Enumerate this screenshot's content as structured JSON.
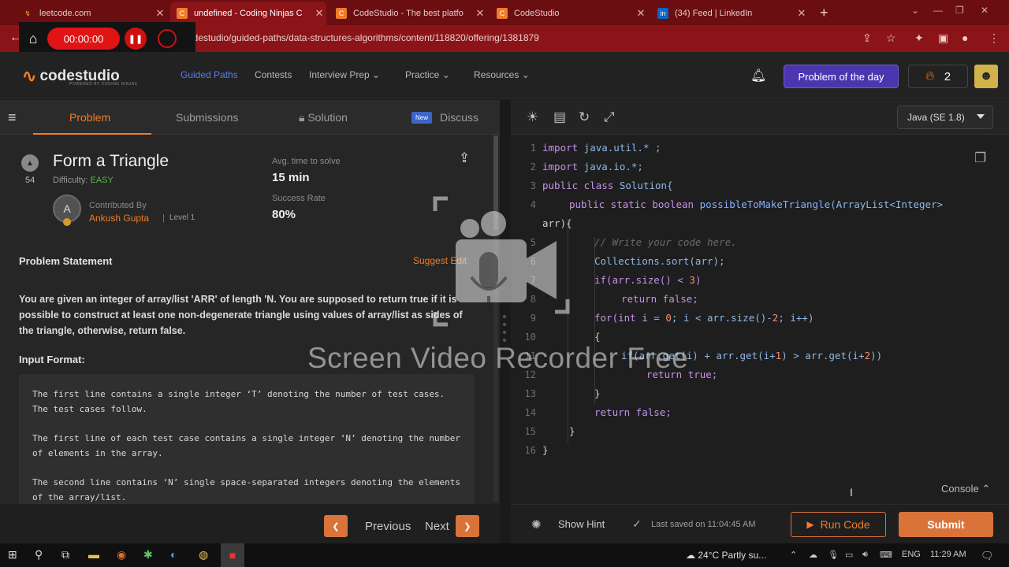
{
  "browser": {
    "tabs": [
      {
        "label": "leetcode.com",
        "favicon": "leetcode-icon",
        "active": false
      },
      {
        "label": "undefined - Coding Ninjas C",
        "favicon": "codingninjas-icon",
        "active": true
      },
      {
        "label": "CodeStudio - The best platfo",
        "favicon": "codingninjas-icon",
        "active": false
      },
      {
        "label": "CodeStudio",
        "favicon": "codingninjas-icon",
        "active": false
      },
      {
        "label": "(34) Feed | LinkedIn",
        "favicon": "linkedin-icon",
        "active": false
      }
    ],
    "url": "odestudio/guided-paths/data-structures-algorithms/content/118820/offering/1381879"
  },
  "recorder": {
    "time": "00:00:00"
  },
  "site": {
    "logo": "codestudio",
    "logo_sub": "POWERED BY CODING NINJAS",
    "nav": [
      "Guided Paths",
      "Contests",
      "Interview Prep",
      "Practice",
      "Resources"
    ],
    "potd": "Problem of the day",
    "streak": "2"
  },
  "problem": {
    "tabs": [
      "Problem",
      "Submissions",
      "Solution",
      "Discuss"
    ],
    "new_badge": "New",
    "upvotes": "54",
    "title": "Form a Triangle",
    "difficulty_label": "Difficulty:",
    "difficulty": "EASY",
    "avg_label": "Avg. time to solve",
    "avg_value": "15 min",
    "success_label": "Success Rate",
    "success_value": "80%",
    "contrib_initial": "A",
    "contrib_label": "Contributed By",
    "contrib_name": "Ankush Gupta",
    "contrib_level": "Level 1",
    "statement_header": "Problem Statement",
    "suggest_edit": "Suggest Edit",
    "statement": "You are given an integer of array/list 'ARR' of length 'N. You are supposed to return true if it is possible to construct at least one non-degenerate triangle using values of array/list as sides of the triangle, otherwise, return false.",
    "input_header": "Input Format:",
    "input_lines": [
      "The first line contains a single integer ‘T’ denoting the number of test cases. The test cases follow.",
      "The first line of each test case contains a single integer ‘N’ denoting the number of elements in the array.",
      "The second line contains ‘N’ single space-separated integers denoting the elements of the array/list."
    ],
    "prev": "Previous",
    "next": "Next"
  },
  "editor": {
    "language": "Java (SE 1.8)",
    "line_numbers": [
      "1",
      "2",
      "3",
      "4",
      "",
      "5",
      "6",
      "7",
      "8",
      "9",
      "10",
      "11",
      "12",
      "13",
      "14",
      "15",
      "16"
    ],
    "code": {
      "l1": [
        "import",
        " java.util.* ;"
      ],
      "l2": [
        "import",
        " java.io.*;"
      ],
      "l3": [
        "public class",
        " Solution{"
      ],
      "l4": [
        "public static boolean",
        " possibleToMakeTriangle(",
        "ArrayList<Integer>"
      ],
      "l4b": "arr){",
      "l5": "// Write your code here.",
      "l6": "Collections.sort(arr);",
      "l7": [
        "if(arr.size() < ",
        "3",
        ")"
      ],
      "l8": [
        "return",
        " false;"
      ],
      "l9": [
        "for(",
        "int",
        " i = ",
        "0",
        "; i < arr.size()-",
        "2",
        "; i++)"
      ],
      "l10": "{",
      "l11": [
        "if(arr.get(i) + arr.get(i+",
        "1",
        ") > arr.get(i+",
        "2",
        "))"
      ],
      "l12": [
        "return",
        " true;"
      ],
      "l13": "}",
      "l14": [
        "return",
        " false;"
      ],
      "l15": "}",
      "l16": "}"
    },
    "console": "Console",
    "show_hint": "Show Hint",
    "last_saved": "Last saved on 11:04:45 AM",
    "run": "Run Code",
    "submit": "Submit"
  },
  "watermark": "Screen Video Recorder Free",
  "taskbar": {
    "weather": "24°C  Partly su...",
    "lang": "ENG",
    "time": "11:29 AM"
  }
}
